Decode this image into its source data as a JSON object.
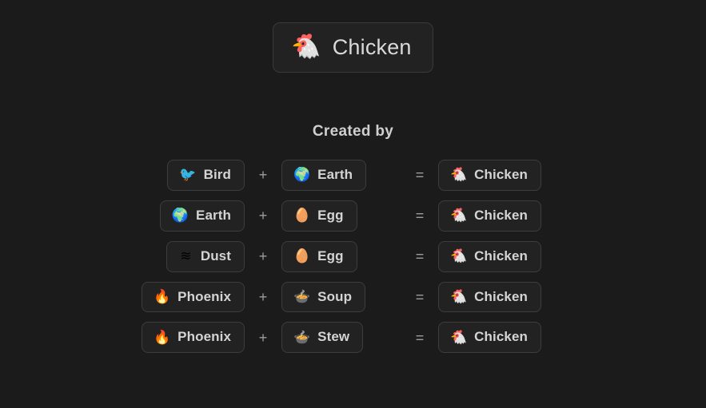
{
  "title": {
    "emoji": "🐔",
    "icon_name": "chicken-emoji",
    "label": "Chicken"
  },
  "section": {
    "heading": "Created by"
  },
  "operators": {
    "plus": "+",
    "equals": "="
  },
  "colors": {
    "background": "#1b1b1b",
    "card_fill": "#222222",
    "card_border": "#3d3d3d",
    "label_text": "#d4d4d4",
    "operator_text": "#9d9d9d",
    "heading_text": "#cfcfcf"
  },
  "recipes": [
    {
      "left": {
        "emoji": "🐦",
        "icon_name": "bird-emoji",
        "label": "Bird"
      },
      "right": {
        "emoji": "🌍",
        "icon_name": "earth-emoji",
        "label": "Earth"
      },
      "result": {
        "emoji": "🐔",
        "icon_name": "chicken-emoji",
        "label": "Chicken"
      }
    },
    {
      "left": {
        "emoji": "🌍",
        "icon_name": "earth-emoji",
        "label": "Earth"
      },
      "right": {
        "emoji": "🥚",
        "icon_name": "egg-emoji",
        "label": "Egg"
      },
      "result": {
        "emoji": "🐔",
        "icon_name": "chicken-emoji",
        "label": "Chicken"
      }
    },
    {
      "left": {
        "emoji": "≋",
        "icon_name": "dust-waves-icon",
        "label": "Dust"
      },
      "right": {
        "emoji": "🥚",
        "icon_name": "egg-emoji",
        "label": "Egg"
      },
      "result": {
        "emoji": "🐔",
        "icon_name": "chicken-emoji",
        "label": "Chicken"
      }
    },
    {
      "left": {
        "emoji": "🔥",
        "icon_name": "fire-emoji",
        "label": "Phoenix"
      },
      "right": {
        "emoji": "🍲",
        "icon_name": "pot-of-food-emoji",
        "label": "Soup"
      },
      "result": {
        "emoji": "🐔",
        "icon_name": "chicken-emoji",
        "label": "Chicken"
      }
    },
    {
      "left": {
        "emoji": "🔥",
        "icon_name": "fire-emoji",
        "label": "Phoenix"
      },
      "right": {
        "emoji": "🍲",
        "icon_name": "pot-of-food-emoji",
        "label": "Stew"
      },
      "result": {
        "emoji": "🐔",
        "icon_name": "chicken-emoji",
        "label": "Chicken"
      }
    }
  ]
}
